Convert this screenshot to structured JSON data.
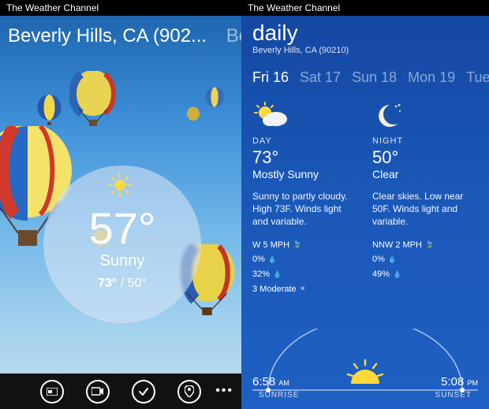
{
  "app_name": "The Weather Channel",
  "left": {
    "location": "Beverly Hills, CA (902...",
    "next_peek": "Boo",
    "current_temp": "57°",
    "condition": "Sunny",
    "high": "73°",
    "low": "50°"
  },
  "right": {
    "title": "daily",
    "subtitle": "Beverly Hills, CA (90210)",
    "tabs": [
      {
        "label": "Fri 16",
        "active": true
      },
      {
        "label": "Sat 17",
        "active": false
      },
      {
        "label": "Sun 18",
        "active": false
      },
      {
        "label": "Mon 19",
        "active": false
      },
      {
        "label": "Tue",
        "active": false
      }
    ],
    "day": {
      "label": "DAY",
      "temp": "73°",
      "cond": "Mostly Sunny",
      "desc": "Sunny to partly cloudy. High 73F. Winds light and variable.",
      "wind": "W 5 MPH",
      "precip": "0%",
      "extra1": "32%",
      "uv": "3 Moderate"
    },
    "night": {
      "label": "NIGHT",
      "temp": "50°",
      "cond": "Clear",
      "desc": "Clear skies. Low near 50F. Winds light and variable.",
      "wind": "NNW 2 MPH",
      "precip": "0%",
      "extra1": "49%"
    },
    "sunrise": {
      "time": "6:58",
      "ampm": "AM",
      "label": "SUNRISE"
    },
    "sunset": {
      "time": "5:08",
      "ampm": "PM",
      "label": "SUNSET"
    }
  },
  "appbar": {
    "icons": [
      "card-icon",
      "camera-icon",
      "check-icon",
      "location-icon"
    ]
  }
}
